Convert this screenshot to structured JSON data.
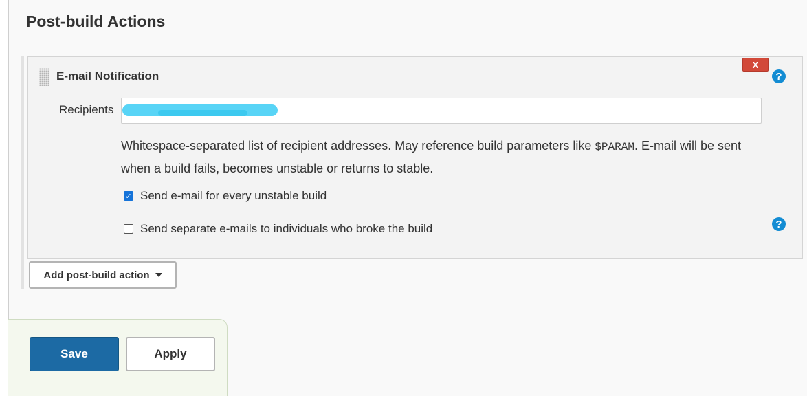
{
  "section": {
    "title": "Post-build Actions"
  },
  "email_notification": {
    "title": "E-mail Notification",
    "delete_label": "X",
    "help_label": "?",
    "recipients_label": "Recipients",
    "recipients_value": "",
    "help_text_part1": "Whitespace-separated list of recipient addresses. May reference build parameters like ",
    "help_text_code": "$PARAM",
    "help_text_part2": ". E-mail will be sent when a build fails, becomes unstable or returns to stable.",
    "checkboxes": [
      {
        "label": "Send e-mail for every unstable build",
        "checked": true
      },
      {
        "label": "Send separate e-mails to individuals who broke the build",
        "checked": false
      }
    ],
    "checkmark": "✓"
  },
  "add_action": {
    "label": "Add post-build action"
  },
  "footer": {
    "save_label": "Save",
    "apply_label": "Apply"
  },
  "colors": {
    "save_button": "#1c6aa4",
    "delete_button": "#d24939",
    "help_icon": "#138cd3",
    "checkbox_checked": "#1573d9"
  }
}
